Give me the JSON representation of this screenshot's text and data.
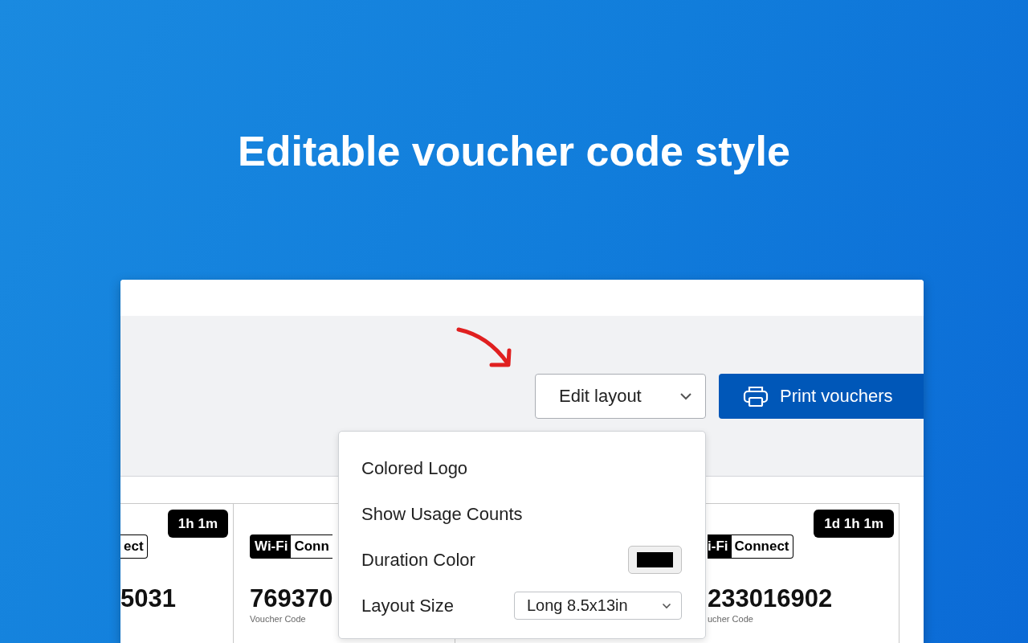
{
  "heading": "Editable voucher code style",
  "toolbar": {
    "layout_dropdown": {
      "label": "Edit layout",
      "expanded": true
    },
    "print_button": {
      "label": "Print vouchers"
    }
  },
  "layout_menu": {
    "items": [
      {
        "kind": "option",
        "label": "Colored Logo"
      },
      {
        "kind": "option",
        "label": "Show Usage Counts"
      },
      {
        "kind": "color",
        "label": "Duration Color",
        "color": "#000000"
      },
      {
        "kind": "select",
        "label": "Layout Size",
        "value": "Long 8.5x13in"
      }
    ]
  },
  "vouchers": [
    {
      "duration": "1h 1m",
      "connect": "ect",
      "code": "5031"
    },
    {
      "wifi": "Wi-Fi",
      "connect": "Conn",
      "code": "769370",
      "caption": "Voucher Code"
    },
    {
      "duration": "1d 1h 1m",
      "wifi": "i-Fi",
      "connect": "Connect",
      "code": "233016902",
      "caption": "ucher Code"
    }
  ]
}
